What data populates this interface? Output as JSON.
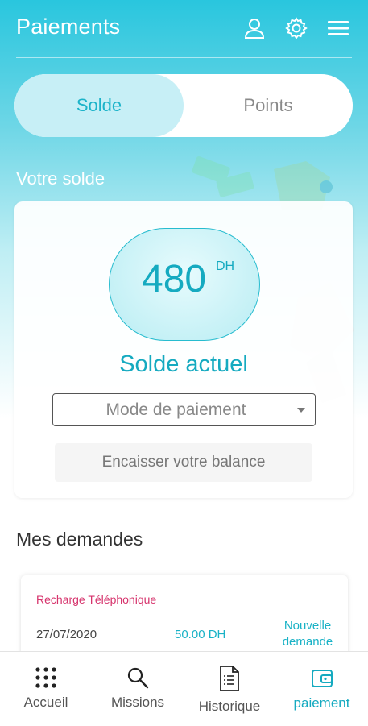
{
  "colors": {
    "accent": "#15aac0",
    "header_gradient_top": "#29c6de",
    "request_type": "#d6336c"
  },
  "header": {
    "title": "Paiements",
    "icons": [
      "user-icon",
      "gear-icon",
      "menu-icon"
    ]
  },
  "tabs": [
    {
      "label": "Solde",
      "active": true
    },
    {
      "label": "Points",
      "active": false
    }
  ],
  "balance_section": {
    "title": "Votre solde",
    "amount": "480",
    "currency": "DH",
    "label": "Solde actuel",
    "payment_mode_placeholder": "Mode de paiement",
    "cash_button_label": "Encaisser votre balance"
  },
  "requests": {
    "title": "Mes demandes",
    "items": [
      {
        "type": "Recharge Téléphonique",
        "date": "27/07/2020",
        "amount": "50.00 DH",
        "status_line1": "Nouvelle",
        "status_line2": "demande"
      }
    ]
  },
  "bottom_nav": [
    {
      "label": "Accueil",
      "icon": "grid-icon",
      "active": false
    },
    {
      "label": "Missions",
      "icon": "search-icon",
      "active": false
    },
    {
      "label": "Historique",
      "icon": "document-icon",
      "active": false
    },
    {
      "label": "paiement",
      "icon": "wallet-icon",
      "active": true
    }
  ]
}
